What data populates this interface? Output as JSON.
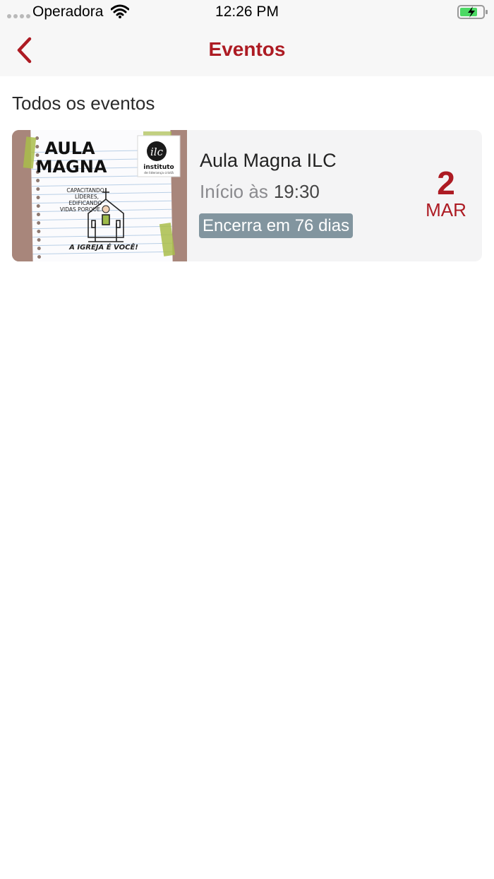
{
  "status_bar": {
    "carrier": "Operadora",
    "time": "12:26 PM",
    "icons": [
      "signal-dots-icon",
      "wifi-icon",
      "battery-charging-icon"
    ]
  },
  "nav": {
    "title": "Eventos",
    "back_icon": "chevron-left-icon"
  },
  "section": {
    "title": "Todos os eventos"
  },
  "events": [
    {
      "name": "Aula Magna ILC",
      "start_label": "Início às",
      "start_time": "19:30",
      "ends_badge": "Encerra em 76 dias",
      "day": "2",
      "month": "MAR",
      "poster": {
        "title_line1": "AULA",
        "title_line2": "MAGNA",
        "subtitle_line1": "CAPACITANDO",
        "subtitle_line2": "LÍDERES,",
        "subtitle_line3": "EDIFICANDO",
        "subtitle_line4": "VIDAS PORQUE...",
        "tagline": "A IGREJA É VOCÊ!",
        "logo_mark": "ilc",
        "logo_name": "instituto",
        "logo_sub": "de liderança cristã"
      }
    }
  ],
  "colors": {
    "accent": "#ad1b23",
    "badge": "#82959f",
    "card": "#f4f4f5",
    "bar": "#f7f7f7"
  }
}
